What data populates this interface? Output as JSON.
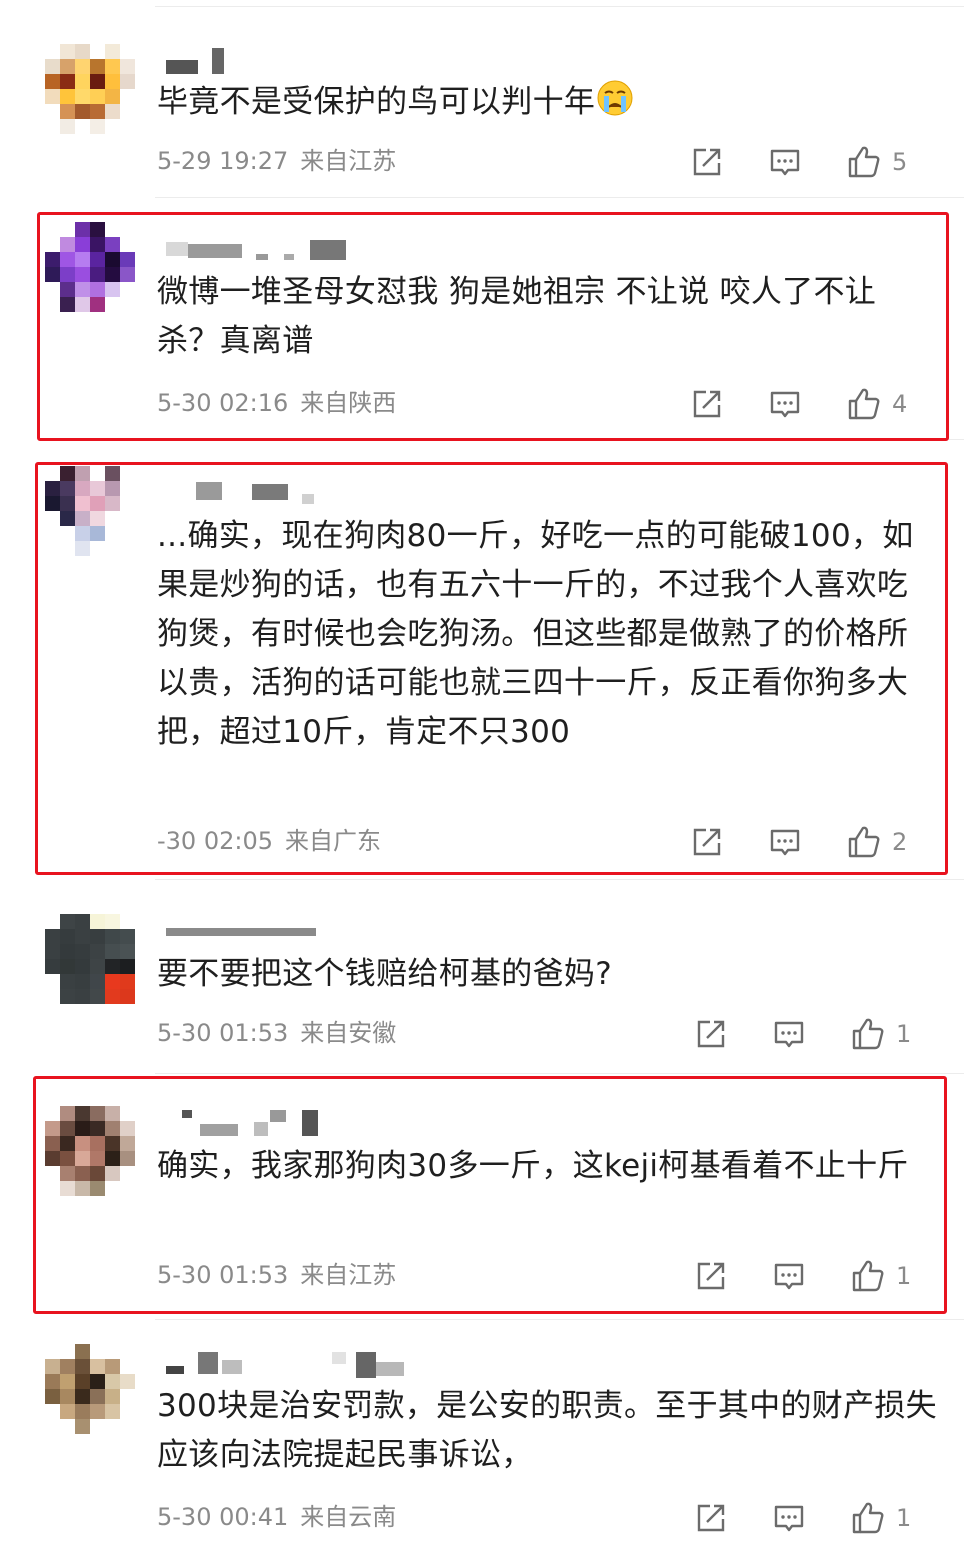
{
  "comments": [
    {
      "text": "毕竟不是受保护的鸟可以判十年",
      "date": "5-29 19:27",
      "location": "来自江苏",
      "likes": "5",
      "emoji": "crying-face",
      "highlighted": false
    },
    {
      "text": "微博一堆圣母女怼我  狗是她祖宗  不让说  咬人了不让杀？真离谱",
      "date": "5-30 02:16",
      "location": "来自陕西",
      "likes": "4",
      "highlighted": true
    },
    {
      "text": "...确实，现在狗肉80一斤，好吃一点的可能破100，如果是炒狗的话，也有五六十一斤的，不过我个人喜欢吃狗煲，有时候也会吃狗汤。但这些都是做熟了的价格所以贵，活狗的话可能也就三四十一斤，反正看你狗多大把，超过10斤，肯定不只300",
      "date": "-30 02:05",
      "location": "来自广东",
      "likes": "2",
      "highlighted": true
    },
    {
      "text": "要不要把这个钱赔给柯基的爸妈?",
      "date": "5-30 01:53",
      "location": "来自安徽",
      "likes": "1",
      "highlighted": false
    },
    {
      "text": "确实，我家那狗肉30多一斤，这keji柯基看着不止十斤",
      "date": "5-30 01:53",
      "location": "来自江苏",
      "likes": "1",
      "highlighted": true
    },
    {
      "text": "300块是治安罚款，是公安的职责。至于其中的财产损失应该向法院提起民事诉讼，",
      "date": "5-30 00:41",
      "location": "来自云南",
      "likes": "1",
      "highlighted": false
    }
  ],
  "icons": {
    "share": "share-icon",
    "reply": "comment-icon",
    "like": "thumbs-up-icon"
  },
  "colors": {
    "highlight": "#e8131f",
    "meta_text": "#8a8a8a",
    "body_text": "#1f1f1f",
    "icon": "#6b6b6b"
  }
}
